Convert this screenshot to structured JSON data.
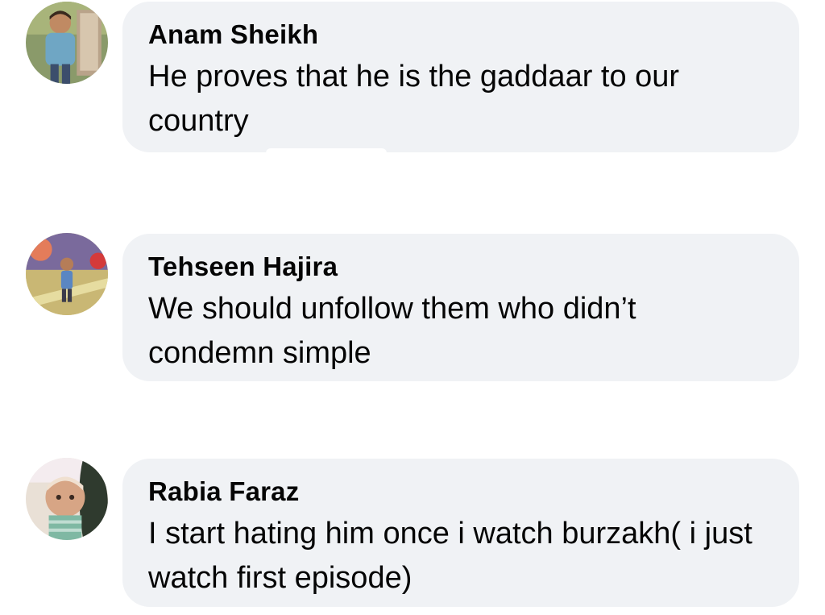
{
  "comments": [
    {
      "author": "Anam Sheikh",
      "text": "He proves that he is the gaddaar to our country",
      "avatar_icon": "child-in-blue-shirt-photo"
    },
    {
      "author": "Tehseen Hajira",
      "text": "We should unfollow them who didn’t condemn simple",
      "avatar_icon": "child-in-garden-photo"
    },
    {
      "author": "Rabia Faraz",
      "text": "I start hating him once i watch burzakh( i just watch first episode)",
      "avatar_icon": "baby-and-adult-photo"
    }
  ],
  "colors": {
    "bubble_background": "#f0f2f5",
    "text": "#050505",
    "page_background": "#ffffff"
  }
}
